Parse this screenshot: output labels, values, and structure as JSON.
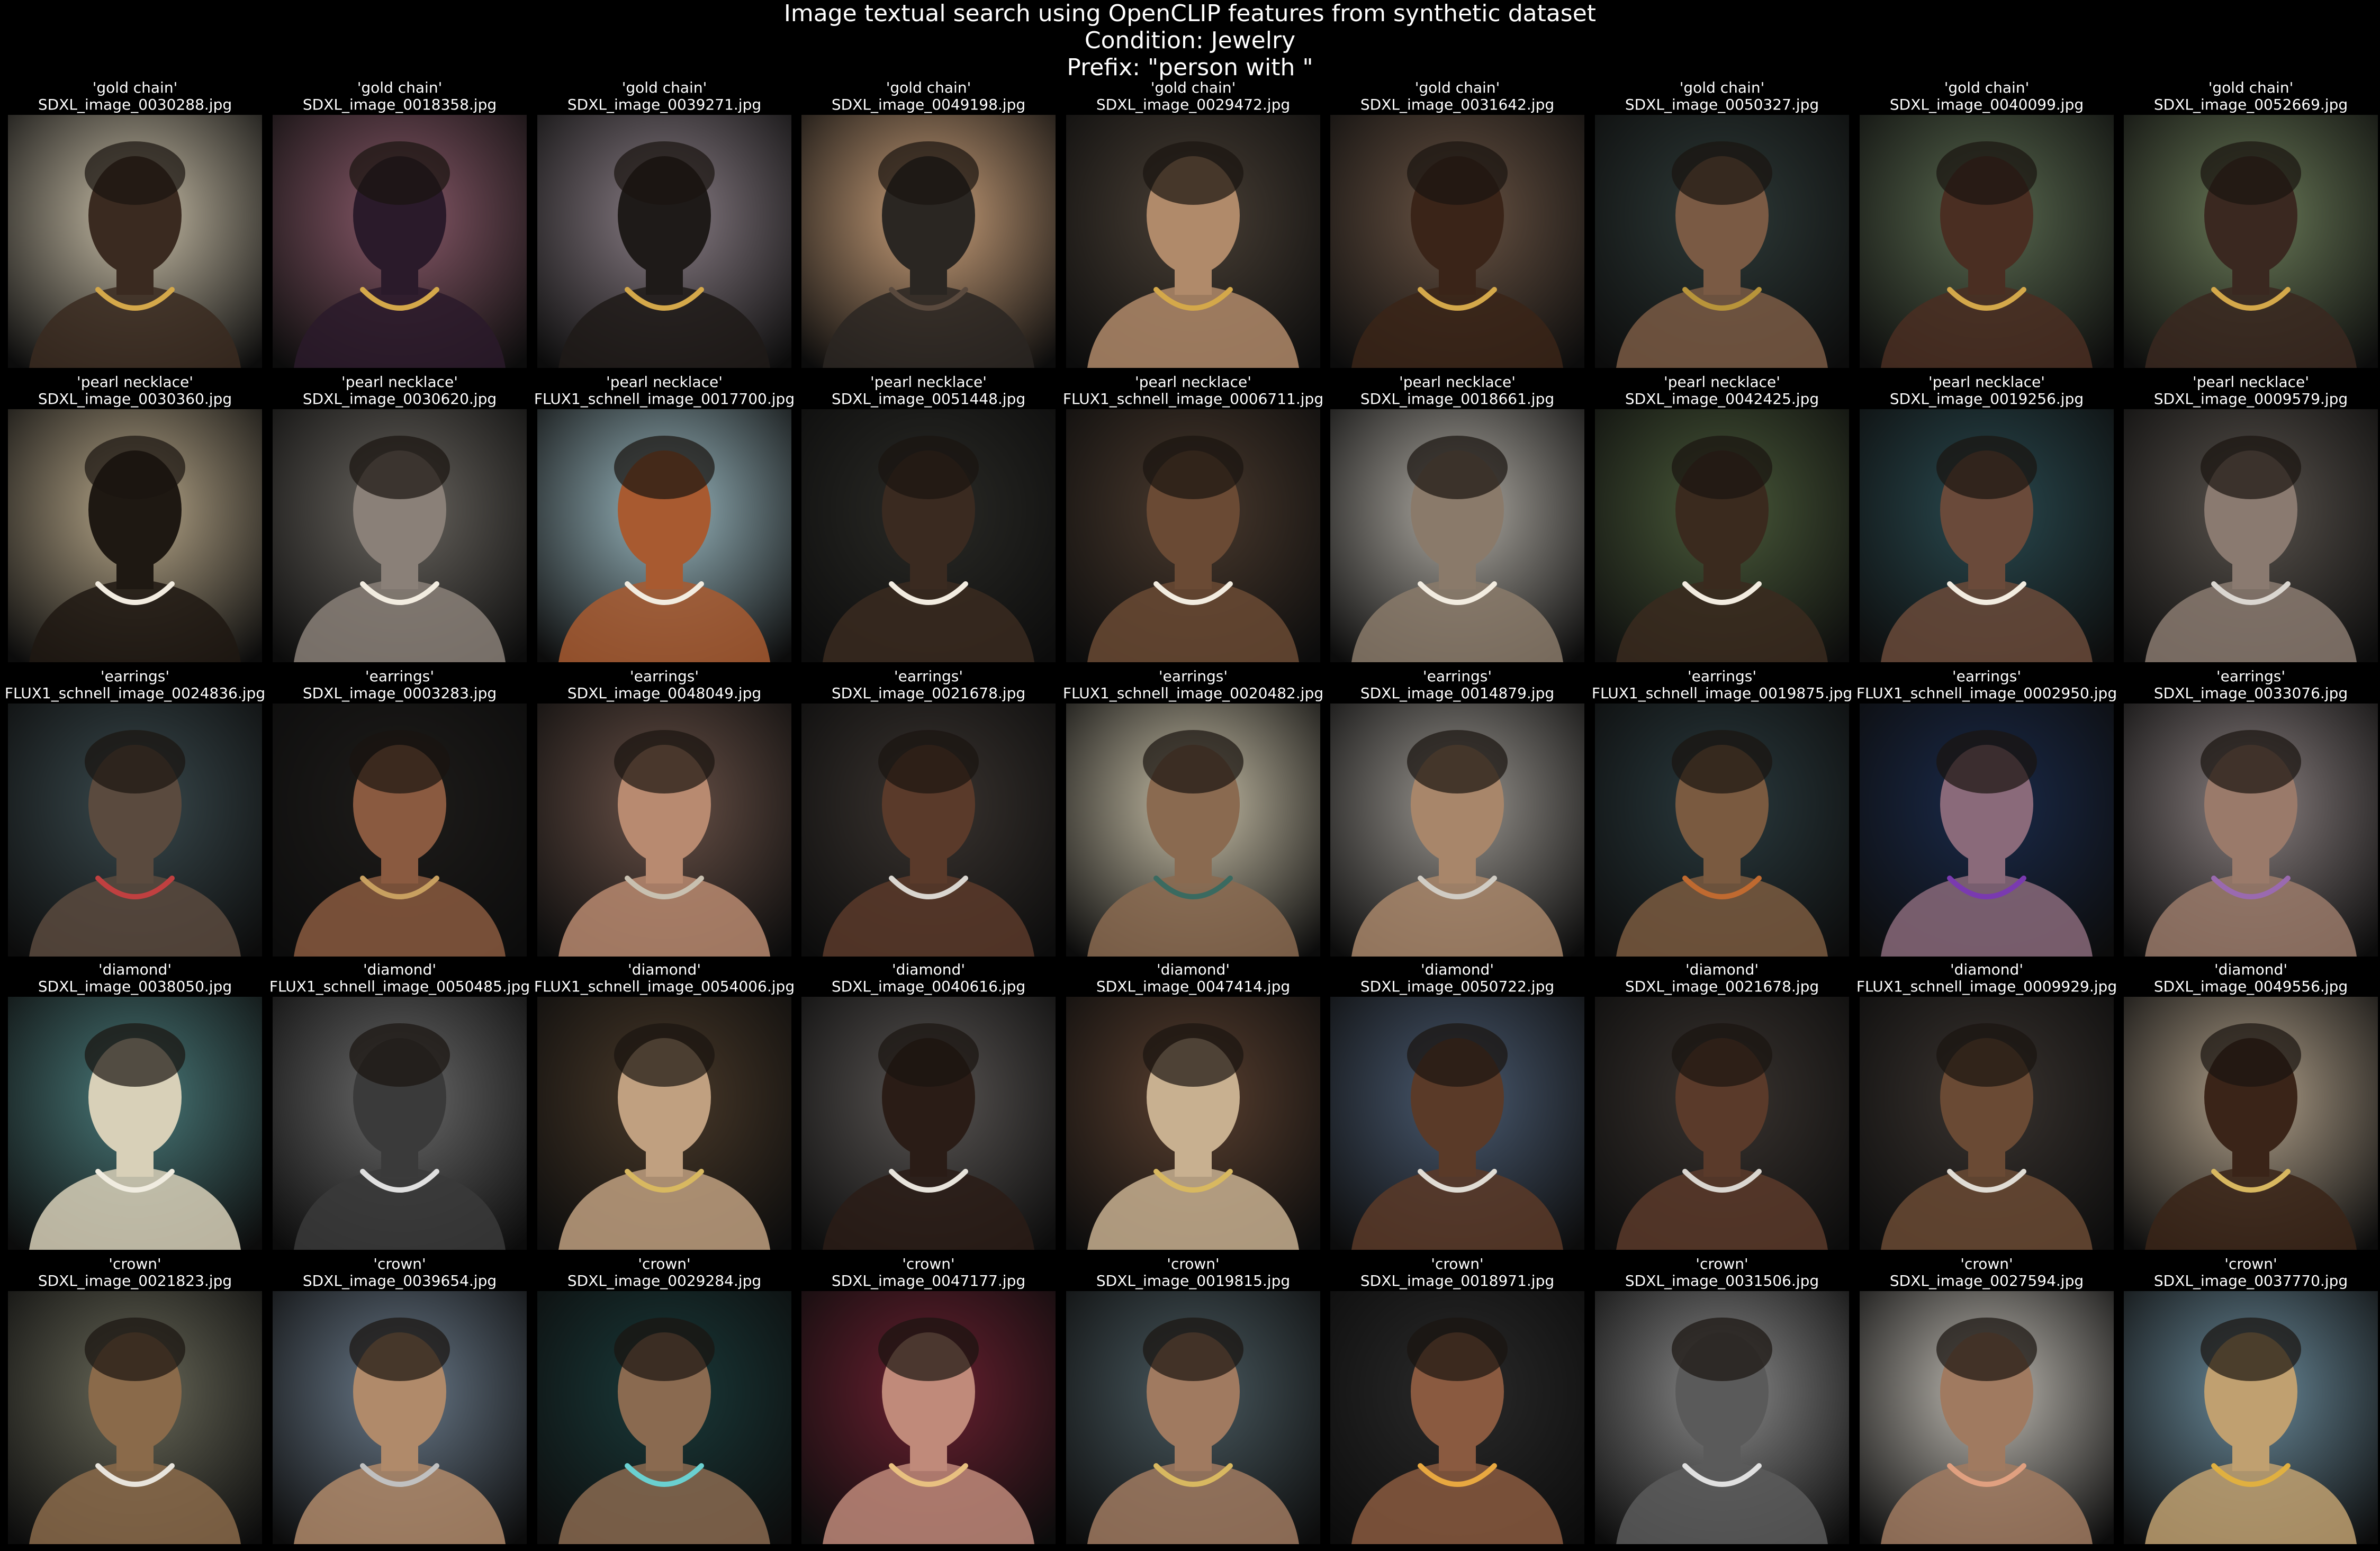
{
  "figure": {
    "title_lines": [
      "Image textual search using OpenCLIP features from synthetic dataset",
      "Condition: Jewelry",
      "Prefix: \"person with \""
    ]
  },
  "rows": [
    {
      "query": "'gold chain'",
      "cells": [
        {
          "query": "'gold chain'",
          "filename": "SDXL_image_0030288.jpg",
          "colors": [
            "#c9bfa8",
            "#3a2a20",
            "#d4a84a"
          ]
        },
        {
          "query": "'gold chain'",
          "filename": "SDXL_image_0018358.jpg",
          "colors": [
            "#8a5a6a",
            "#2a1a2a",
            "#d4a84a"
          ]
        },
        {
          "query": "'gold chain'",
          "filename": "SDXL_image_0039271.jpg",
          "colors": [
            "#8a7e86",
            "#1e1a18",
            "#d4a84a"
          ]
        },
        {
          "query": "'gold chain'",
          "filename": "SDXL_image_0049198.jpg",
          "colors": [
            "#caa07a",
            "#2a2622",
            "#5a4a3e"
          ]
        },
        {
          "query": "'gold chain'",
          "filename": "SDXL_image_0029472.jpg",
          "colors": [
            "#4a4036",
            "#b08a6a",
            "#d4a84a"
          ]
        },
        {
          "query": "'gold chain'",
          "filename": "SDXL_image_0031642.jpg",
          "colors": [
            "#6a5444",
            "#3a2418",
            "#d4a84a"
          ]
        },
        {
          "query": "'gold chain'",
          "filename": "SDXL_image_0050327.jpg",
          "colors": [
            "#2e3a38",
            "#7a5a44",
            "#b8943a"
          ]
        },
        {
          "query": "'gold chain'",
          "filename": "SDXL_image_0040099.jpg",
          "colors": [
            "#5a6a50",
            "#4a2e22",
            "#d4a84a"
          ]
        },
        {
          "query": "'gold chain'",
          "filename": "SDXL_image_0052669.jpg",
          "colors": [
            "#6a7a58",
            "#3a2820",
            "#d4a84a"
          ]
        }
      ]
    },
    {
      "query": "'pearl necklace'",
      "cells": [
        {
          "query": "'pearl necklace'",
          "filename": "SDXL_image_0030360.jpg",
          "colors": [
            "#b8a88a",
            "#1e1812",
            "#f2ece0"
          ]
        },
        {
          "query": "'pearl necklace'",
          "filename": "SDXL_image_0030620.jpg",
          "colors": [
            "#6a6660",
            "#8a8078",
            "#f2ece0"
          ]
        },
        {
          "query": "'pearl necklace'",
          "filename": "FLUX1_schnell_image_0017700.jpg",
          "colors": [
            "#9ab8c0",
            "#a85a30",
            "#f2ece0"
          ]
        },
        {
          "query": "'pearl necklace'",
          "filename": "SDXL_image_0051448.jpg",
          "colors": [
            "#2a2a26",
            "#3a2a20",
            "#f2ece0"
          ]
        },
        {
          "query": "'pearl necklace'",
          "filename": "FLUX1_schnell_image_0006711.jpg",
          "colors": [
            "#4a3a2e",
            "#6a4a34",
            "#f2ece0"
          ]
        },
        {
          "query": "'pearl necklace'",
          "filename": "SDXL_image_0018661.jpg",
          "colors": [
            "#b0aca4",
            "#8a7a6a",
            "#f2ece0"
          ]
        },
        {
          "query": "'pearl necklace'",
          "filename": "SDXL_image_0042425.jpg",
          "colors": [
            "#4a5a3a",
            "#3a2a1e",
            "#f2ece0"
          ]
        },
        {
          "query": "'pearl necklace'",
          "filename": "SDXL_image_0019256.jpg",
          "colors": [
            "#2a4a50",
            "#6a4a3a",
            "#f2ece0"
          ]
        },
        {
          "query": "'pearl necklace'",
          "filename": "SDXL_image_0009579.jpg",
          "colors": [
            "#5a544e",
            "#8a7a70",
            "#dad6d0"
          ]
        }
      ]
    },
    {
      "query": "'earrings'",
      "cells": [
        {
          "query": "'earrings'",
          "filename": "FLUX1_schnell_image_0024836.jpg",
          "colors": [
            "#3a4a4e",
            "#5a4a3e",
            "#c04040"
          ]
        },
        {
          "query": "'earrings'",
          "filename": "SDXL_image_0003283.jpg",
          "colors": [
            "#1e1c1a",
            "#8a5a40",
            "#c8a060"
          ]
        },
        {
          "query": "'earrings'",
          "filename": "SDXL_image_0048049.jpg",
          "colors": [
            "#6a5248",
            "#b88a70",
            "#c8c0b0"
          ]
        },
        {
          "query": "'earrings'",
          "filename": "SDXL_image_0021678.jpg",
          "colors": [
            "#3a3430",
            "#5a3a2a",
            "#dad6d0"
          ]
        },
        {
          "query": "'earrings'",
          "filename": "FLUX1_schnell_image_0020482.jpg",
          "colors": [
            "#c8c0a8",
            "#8a6a50",
            "#3a6a60"
          ]
        },
        {
          "query": "'earrings'",
          "filename": "SDXL_image_0014879.jpg",
          "colors": [
            "#9a9690",
            "#a8866a",
            "#d0ccc4"
          ]
        },
        {
          "query": "'earrings'",
          "filename": "FLUX1_schnell_image_0019875.jpg",
          "colors": [
            "#2a3a3e",
            "#7a5a40",
            "#c06a30"
          ]
        },
        {
          "query": "'earrings'",
          "filename": "FLUX1_schnell_image_0002950.jpg",
          "colors": [
            "#1a2a4a",
            "#8a6a7a",
            "#7a3ab0"
          ]
        },
        {
          "query": "'earrings'",
          "filename": "SDXL_image_0033076.jpg",
          "colors": [
            "#8a8080",
            "#9a7a6a",
            "#9a6ab0"
          ]
        }
      ]
    },
    {
      "query": "'diamond'",
      "cells": [
        {
          "query": "'diamond'",
          "filename": "SDXL_image_0038050.jpg",
          "colors": [
            "#4a7a7a",
            "#d8d0b8",
            "#f0ece0"
          ]
        },
        {
          "query": "'diamond'",
          "filename": "FLUX1_schnell_image_0050485.jpg",
          "colors": [
            "#6a6a6a",
            "#3a3a3a",
            "#e0e0e0"
          ]
        },
        {
          "query": "'diamond'",
          "filename": "FLUX1_schnell_image_0054006.jpg",
          "colors": [
            "#4a3a2a",
            "#c0a080",
            "#d8b860"
          ]
        },
        {
          "query": "'diamond'",
          "filename": "SDXL_image_0040616.jpg",
          "colors": [
            "#5a5654",
            "#2a1c16",
            "#e8e4dc"
          ]
        },
        {
          "query": "'diamond'",
          "filename": "SDXL_image_0047414.jpg",
          "colors": [
            "#5a4030",
            "#c8b090",
            "#d8b860"
          ]
        },
        {
          "query": "'diamond'",
          "filename": "SDXL_image_0050722.jpg",
          "colors": [
            "#4a5a70",
            "#5a3a28",
            "#e0dcd4"
          ]
        },
        {
          "query": "'diamond'",
          "filename": "SDXL_image_0021678.jpg",
          "colors": [
            "#3a3430",
            "#5a3a2a",
            "#dad6d0"
          ]
        },
        {
          "query": "'diamond'",
          "filename": "FLUX1_schnell_image_0009929.jpg",
          "colors": [
            "#3a3430",
            "#6a4a34",
            "#e0dcd4"
          ]
        },
        {
          "query": "'diamond'",
          "filename": "SDXL_image_0049556.jpg",
          "colors": [
            "#b0a08a",
            "#3a2418",
            "#d8b860"
          ]
        }
      ]
    },
    {
      "query": "'crown'",
      "cells": [
        {
          "query": "'crown'",
          "filename": "SDXL_image_0021823.jpg",
          "colors": [
            "#6a6a5a",
            "#8a6a4a",
            "#e8e4dc"
          ]
        },
        {
          "query": "'crown'",
          "filename": "SDXL_image_0039654.jpg",
          "colors": [
            "#6a7a8a",
            "#b08a6a",
            "#c0c0c0"
          ]
        },
        {
          "query": "'crown'",
          "filename": "SDXL_image_0029284.jpg",
          "colors": [
            "#1a3a3a",
            "#8a6a50",
            "#6ad0d0"
          ]
        },
        {
          "query": "'crown'",
          "filename": "SDXL_image_0047177.jpg",
          "colors": [
            "#6a2030",
            "#c08a7a",
            "#e8c080"
          ]
        },
        {
          "query": "'crown'",
          "filename": "SDXL_image_0019815.jpg",
          "colors": [
            "#4a5a60",
            "#a07a60",
            "#d8b860"
          ]
        },
        {
          "query": "'crown'",
          "filename": "SDXL_image_0018971.jpg",
          "colors": [
            "#2a2a2a",
            "#8a5a40",
            "#e8a840"
          ]
        },
        {
          "query": "'crown'",
          "filename": "SDXL_image_0031506.jpg",
          "colors": [
            "#8a8a8a",
            "#5a5a5a",
            "#e0e0e0"
          ]
        },
        {
          "query": "'crown'",
          "filename": "SDXL_image_0027594.jpg",
          "colors": [
            "#c0bcb4",
            "#a07a60",
            "#e0a080"
          ]
        },
        {
          "query": "'crown'",
          "filename": "SDXL_image_0037770.jpg",
          "colors": [
            "#6a8a9a",
            "#c0a070",
            "#e0b040"
          ]
        }
      ]
    }
  ]
}
